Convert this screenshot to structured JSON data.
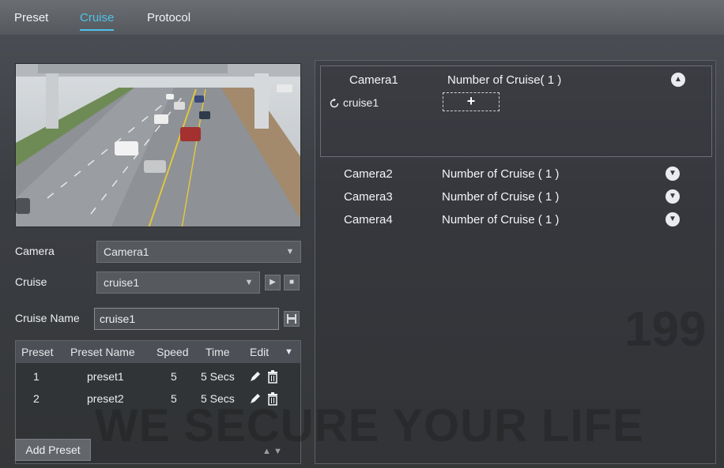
{
  "tabs": [
    {
      "label": "Preset",
      "active": false
    },
    {
      "label": "Cruise",
      "active": true
    },
    {
      "label": "Protocol",
      "active": false
    }
  ],
  "accent_color": "#4fc3e8",
  "left": {
    "camera_label": "Camera",
    "camera_value": "Camera1",
    "cruise_label": "Cruise",
    "cruise_value": "cruise1",
    "cruise_name_label": "Cruise Name",
    "cruise_name_value": "cruise1",
    "table": {
      "headers": [
        "Preset",
        "Preset Name",
        "Speed",
        "Time",
        "Edit"
      ],
      "rows": [
        {
          "preset": "1",
          "name": "preset1",
          "speed": "5",
          "time": "5 Secs"
        },
        {
          "preset": "2",
          "name": "preset2",
          "speed": "5",
          "time": "5 Secs"
        }
      ]
    },
    "add_preset_label": "Add Preset"
  },
  "right": {
    "cameras": [
      {
        "name": "Camera1",
        "count": "Number of Cruise( 1 )",
        "expanded": true
      },
      {
        "name": "Camera2",
        "count": "Number of Cruise ( 1 )",
        "expanded": false
      },
      {
        "name": "Camera3",
        "count": "Number of Cruise ( 1 )",
        "expanded": false
      },
      {
        "name": "Camera4",
        "count": "Number of Cruise ( 1 )",
        "expanded": false
      }
    ],
    "cruise_item": "cruise1",
    "add_cruise_glyph": "+"
  },
  "watermark": {
    "text": "WE SECURE YOUR LIFE",
    "number": "199"
  },
  "icons": {
    "collapse": "chevron-up-icon",
    "expand": "chevron-down-icon",
    "refresh": "refresh-icon",
    "edit": "pencil-icon",
    "delete": "trash-icon",
    "play": "play-icon",
    "stop": "stop-icon",
    "save": "save-icon"
  }
}
